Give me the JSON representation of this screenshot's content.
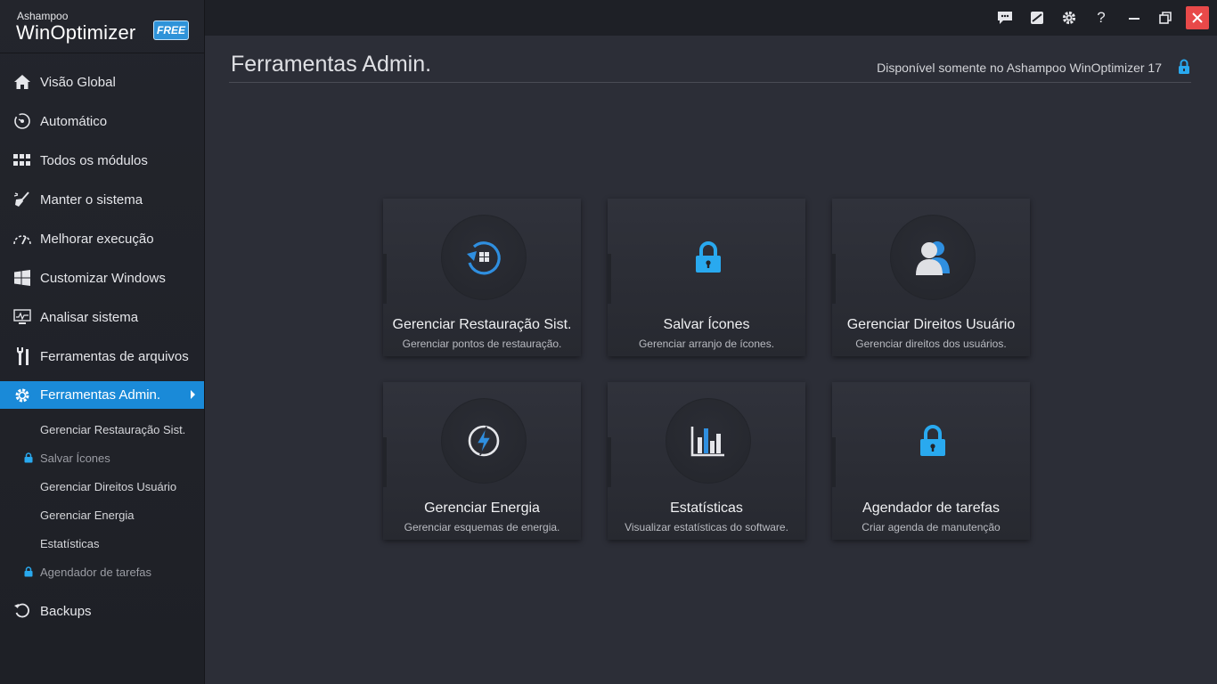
{
  "app": {
    "brand_small": "Ashampoo",
    "brand_name": "WinOptimizer",
    "badge": "FREE"
  },
  "sidebar": {
    "items": [
      {
        "label": "Visão Global",
        "icon": "home-icon"
      },
      {
        "label": "Automático",
        "icon": "auto-icon"
      },
      {
        "label": "Todos os módulos",
        "icon": "grid-icon"
      },
      {
        "label": "Manter o sistema",
        "icon": "broom-icon"
      },
      {
        "label": "Melhorar execução",
        "icon": "speedometer-icon"
      },
      {
        "label": "Customizar Windows",
        "icon": "windows-icon"
      },
      {
        "label": "Analisar sistema",
        "icon": "monitor-chart-icon"
      },
      {
        "label": "Ferramentas de arquivos",
        "icon": "tools-icon"
      },
      {
        "label": "Ferramentas Admin.",
        "icon": "gear-icon",
        "active": true
      }
    ],
    "sub_items": [
      {
        "label": "Gerenciar Restauração Sist.",
        "locked": false
      },
      {
        "label": "Salvar Ícones",
        "locked": true
      },
      {
        "label": "Gerenciar Direitos Usuário",
        "locked": false
      },
      {
        "label": "Gerenciar Energia",
        "locked": false
      },
      {
        "label": "Estatísticas",
        "locked": false
      },
      {
        "label": "Agendador de tarefas",
        "locked": true
      }
    ],
    "backups": {
      "label": "Backups",
      "icon": "restore-icon"
    }
  },
  "titlebar": {
    "buttons": [
      "feedback-icon",
      "skin-icon",
      "settings-icon",
      "help-icon",
      "minimize-icon",
      "restore-window-icon",
      "close-icon"
    ],
    "help_glyph": "?"
  },
  "main": {
    "title": "Ferramentas Admin.",
    "notice": "Disponível somente no Ashampoo WinOptimizer 17",
    "cards": [
      {
        "title": "Gerenciar Restauração Sist.",
        "subtitle": "Gerenciar pontos de restauração.",
        "icon": "system-restore-icon"
      },
      {
        "title": "Salvar Ícones",
        "subtitle": "Gerenciar arranjo de ícones.",
        "icon": "lock-icon"
      },
      {
        "title": "Gerenciar Direitos Usuário",
        "subtitle": "Gerenciar direitos dos usuários.",
        "icon": "users-icon"
      },
      {
        "title": "Gerenciar Energia",
        "subtitle": "Gerenciar esquemas de energia.",
        "icon": "power-icon"
      },
      {
        "title": "Estatísticas",
        "subtitle": "Visualizar estatísticas do software.",
        "icon": "bar-chart-icon"
      },
      {
        "title": "Agendador de tarefas",
        "subtitle": "Criar agenda de manutenção",
        "icon": "lock-icon"
      }
    ]
  },
  "colors": {
    "accent": "#1a8ad8",
    "lock": "#29a9ef",
    "close": "#e84949",
    "background": "#2c2e37",
    "sidebar": "#23252c"
  }
}
